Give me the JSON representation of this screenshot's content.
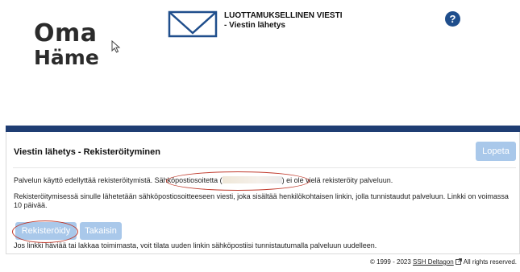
{
  "logo": {
    "line1": "Oma",
    "line2": "Häme"
  },
  "header": {
    "title": "LUOTTAMUKSELLINEN VIESTI",
    "subtitle": "- Viestin lähetys",
    "help_symbol": "?"
  },
  "panel": {
    "title": "Viestin lähetys - Rekisteröityminen",
    "logout_label": "Lopeta",
    "intro_before": "Palvelun käyttö edellyttää rekisteröitymistä. Sähköpostiosoitetta (",
    "intro_after": ") ei ole vielä rekisteröity palveluun.",
    "info": "Rekisteröitymisessä sinulle lähetetään sähköpostiosoitteeseen viesti, joka sisältää henkilökohtaisen linkin, jolla tunnistaudut palveluun. Linkki on voimassa 10 päivää.",
    "register_label": "Rekisteröidy",
    "back_label": "Takaisin",
    "note": "Jos linkki häviää tai lakkaa toimimasta, voit tilata uuden linkin sähköpostiisi tunnistautumalla palveluun uudelleen."
  },
  "footer": {
    "copyright": "© 1999 - 2023",
    "company_link": "SSH Deltagon",
    "rights": "All rights reserved."
  },
  "colors": {
    "brand_navy": "#1f3d73",
    "button_blue": "#a9c8ea",
    "help_blue": "#1f4e8c",
    "highlight_red": "#c0392b"
  },
  "icons": [
    "heart-icon",
    "cursor-icon",
    "envelope-icon",
    "help-icon",
    "external-link-icon"
  ]
}
